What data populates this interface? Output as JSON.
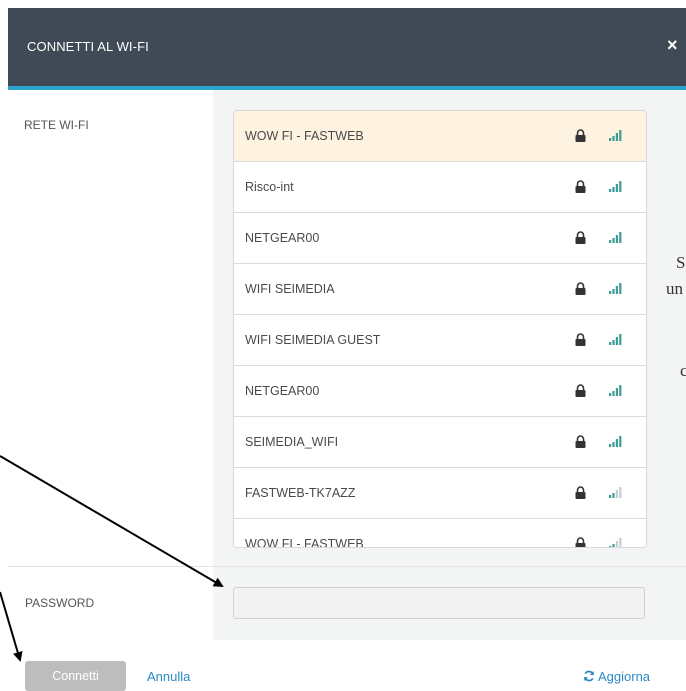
{
  "dialog": {
    "title": "CONNETTI AL WI-FI",
    "close_icon": "×",
    "header_color": "#3f4a56",
    "accent_color": "#2ba3cf"
  },
  "wifi_label": "RETE WI-FI",
  "networks": [
    {
      "name": "WOW FI - FASTWEB",
      "secured": true,
      "signal_bars": 4,
      "selected": true
    },
    {
      "name": "Risco-int",
      "secured": true,
      "signal_bars": 4
    },
    {
      "name": "NETGEAR00",
      "secured": true,
      "signal_bars": 4
    },
    {
      "name": "WIFI SEIMEDIA",
      "secured": true,
      "signal_bars": 4
    },
    {
      "name": "WIFI SEIMEDIA GUEST",
      "secured": true,
      "signal_bars": 4
    },
    {
      "name": "NETGEAR00",
      "secured": true,
      "signal_bars": 4
    },
    {
      "name": "SEIMEDIA_WIFI",
      "secured": true,
      "signal_bars": 4
    },
    {
      "name": "FASTWEB-TK7AZZ",
      "secured": true,
      "signal_bars": 2
    },
    {
      "name": "WOW FI - FASTWEB",
      "secured": true,
      "signal_bars": 2
    }
  ],
  "password": {
    "label": "PASSWORD",
    "value": ""
  },
  "footer": {
    "connect_label": "Connetti",
    "cancel_label": "Annulla",
    "refresh_label": "Aggiorna",
    "refresh_icon": "refresh-icon"
  },
  "side_text": {
    "line1": "S",
    "line2": "un",
    "line3": "c"
  }
}
